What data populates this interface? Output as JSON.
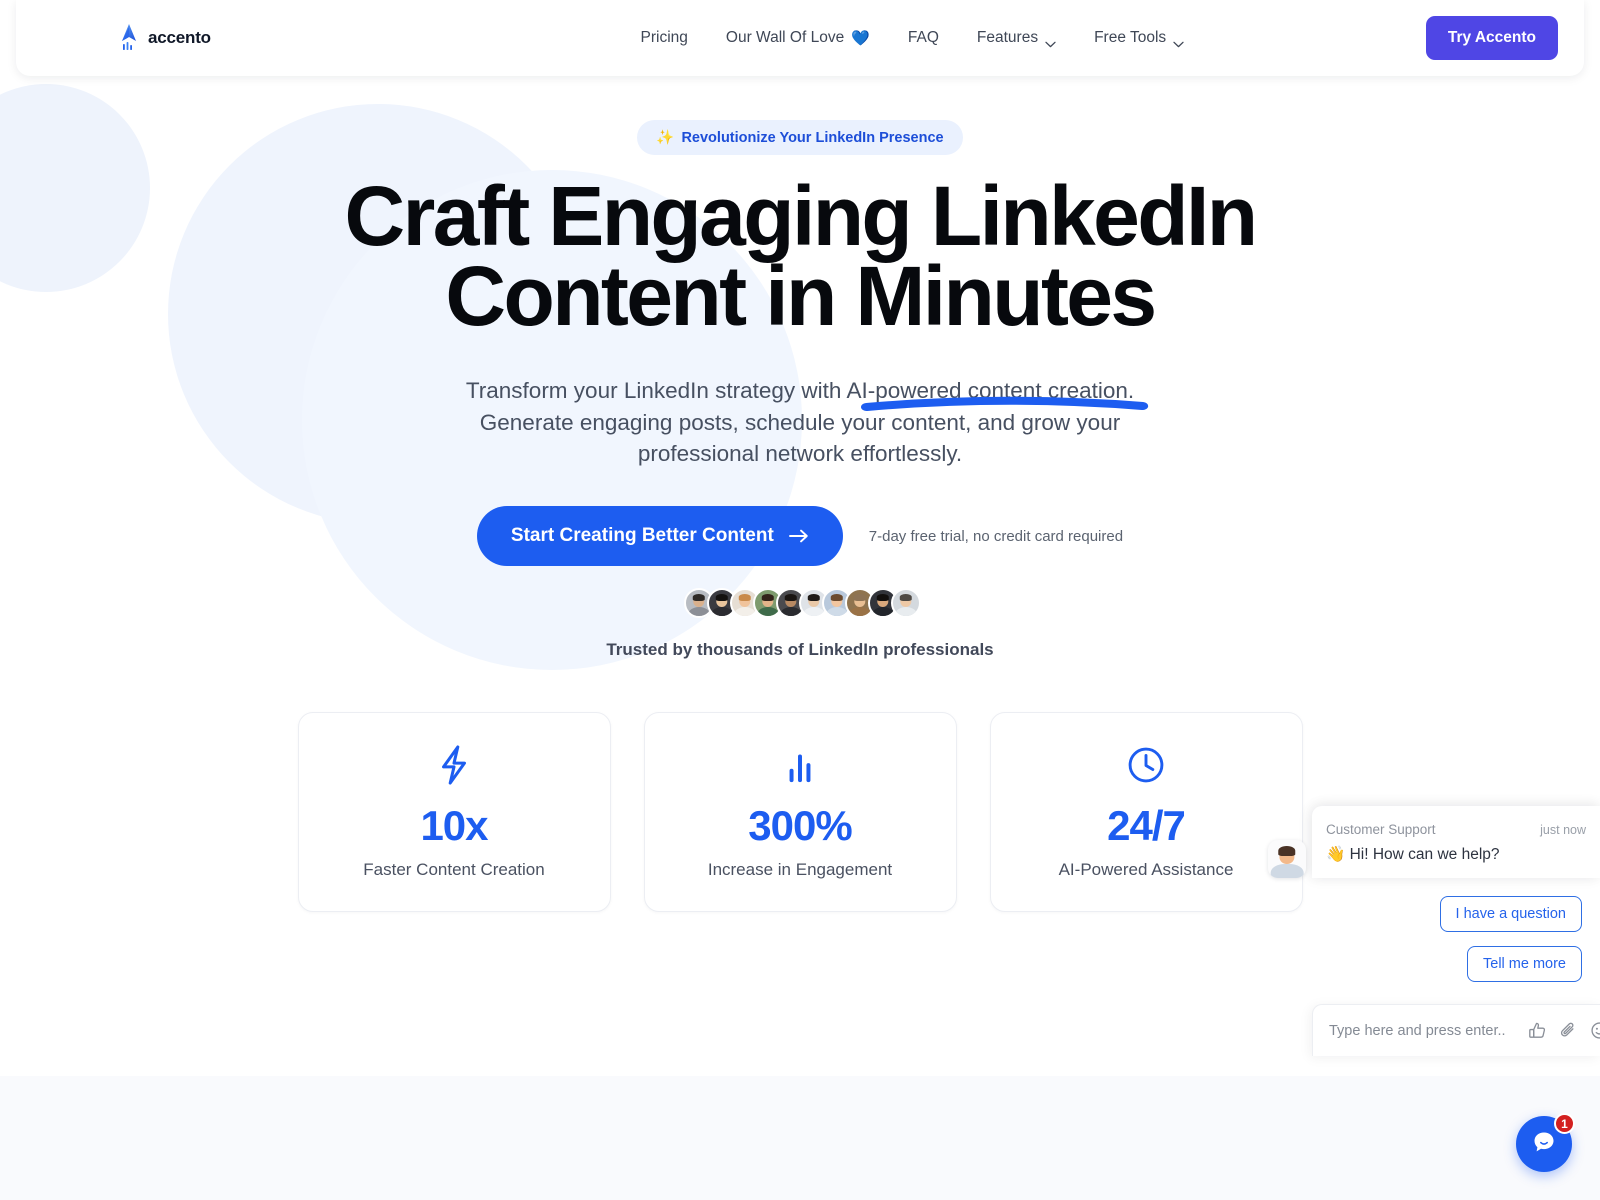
{
  "brand": {
    "name": "accento",
    "logo_icon": "rocket-logo-icon"
  },
  "nav": {
    "items": [
      {
        "label": "Pricing",
        "icon": "",
        "caret": false
      },
      {
        "label": "Our Wall Of Love",
        "icon": "💙",
        "caret": false
      },
      {
        "label": "FAQ",
        "icon": "",
        "caret": false
      },
      {
        "label": "Features",
        "icon": "",
        "caret": true
      },
      {
        "label": "Free Tools",
        "icon": "",
        "caret": true
      }
    ],
    "cta_label": "Try Accento"
  },
  "hero": {
    "eyebrow_icon": "✨",
    "eyebrow": "Revolutionize Your LinkedIn Presence",
    "headline_line1": "Craft Engaging LinkedIn",
    "headline_line2a": "Content in ",
    "headline_line2b": "Minutes",
    "subhead": "Transform your LinkedIn strategy with AI-powered content creation. Generate engaging posts, schedule your content, and grow your professional network effortlessly.",
    "cta_label": "Start Creating Better Content",
    "cta_icon": "arrow-right-icon",
    "trial_note": "7-day free trial, no credit card required",
    "trusted_text": "Trusted by thousands of LinkedIn professionals",
    "avatars": [
      {
        "skin": "#d9b08c",
        "hair": "#2f2a26",
        "shirt": "#8c8f96",
        "bg": "#b8bcc2"
      },
      {
        "skin": "#e8c49c",
        "hair": "#14110f",
        "shirt": "#2b2b30",
        "bg": "#3a3a40"
      },
      {
        "skin": "#f0c39b",
        "hair": "#c98a4a",
        "shirt": "#f3efe9",
        "bg": "#e6ded4"
      },
      {
        "skin": "#e2b489",
        "hair": "#32231a",
        "shirt": "#3f6b4a",
        "bg": "#7e9b6e"
      },
      {
        "skin": "#b88a63",
        "hair": "#1a1512",
        "shirt": "#2a2b2f",
        "bg": "#4a4a4e"
      },
      {
        "skin": "#eac9a8",
        "hair": "#201b18",
        "shirt": "#eef1f4",
        "bg": "#dfe3e8"
      },
      {
        "skin": "#f2c6a0",
        "hair": "#6b4a2e",
        "shirt": "#cfdbe8",
        "bg": "#b9c9dc"
      },
      {
        "skin": "#e9bf93",
        "hair": "#8d7355",
        "shirt": "#9a7246",
        "bg": "#8f744f"
      },
      {
        "skin": "#d9a87c",
        "hair": "#120f0d",
        "shirt": "#22252b",
        "bg": "#32343a"
      },
      {
        "skin": "#eec9a6",
        "hair": "#4e4944",
        "shirt": "#e8ecef",
        "bg": "#d4d9de"
      }
    ]
  },
  "stats": [
    {
      "icon": "lightning-bolt-icon",
      "value": "10x",
      "label": "Faster Content Creation"
    },
    {
      "icon": "bar-chart-icon",
      "value": "300%",
      "label": "Increase in Engagement"
    },
    {
      "icon": "clock-icon",
      "value": "24/7",
      "label": "AI-Powered Assistance"
    }
  ],
  "chat": {
    "sender": "Customer Support",
    "time": "just now",
    "message": "👋 Hi! How can we help?",
    "quick_replies": [
      "I have a question",
      "Tell me more"
    ],
    "input_placeholder": "Type here and press enter..",
    "input_value": "",
    "tools": [
      "thumbs-up-icon",
      "paperclip-icon",
      "emoji-icon"
    ],
    "launcher_badge": "1"
  },
  "colors": {
    "brand_blue": "#1d5df0",
    "nav_cta_purple": "#4f46e5",
    "eyebrow_bg": "#eaf1fe",
    "eyebrow_text": "#1d4ed8",
    "badge_red": "#d32020",
    "lower_band": "#f9fafd"
  }
}
